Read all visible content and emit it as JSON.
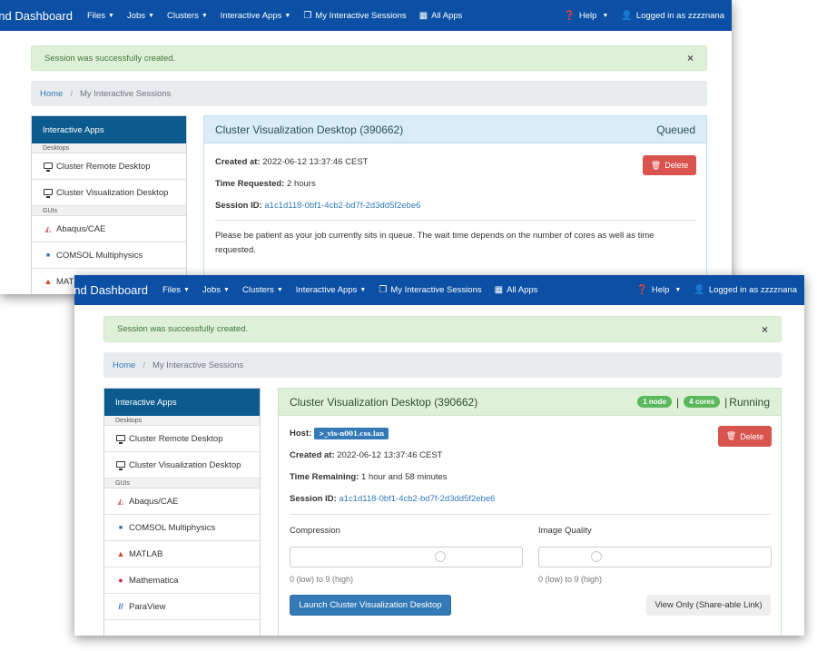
{
  "brand": "emand Dashboard",
  "nav": {
    "files": "Files",
    "jobs": "Jobs",
    "clusters": "Clusters",
    "interactive_apps": "Interactive Apps",
    "my_sessions": "My Interactive Sessions",
    "all_apps": "All Apps",
    "help": "Help",
    "login": "Logged in as zzzznana"
  },
  "alert": {
    "text": "Session was successfully created.",
    "close": "×"
  },
  "breadcrumb": {
    "home": "Home",
    "separator": "/",
    "current": "My Interactive Sessions"
  },
  "sidebar": {
    "header": "Interactive Apps",
    "categories": {
      "desktops": "Desktops",
      "guis": "GUIs"
    },
    "items": {
      "remote_desktop": "Cluster Remote Desktop",
      "vis_desktop": "Cluster Visualization Desktop",
      "abaqus": "Abaqus/CAE",
      "comsol": "COMSOL Multiphysics",
      "matlab": "MATLAB",
      "matlab_partial": "MATL",
      "mathematica": "Mathematica",
      "paraview": "ParaView"
    }
  },
  "session": {
    "title": "Cluster Visualization Desktop (390662)",
    "created_label": "Created at:",
    "created_value": "2022-06-12 13:37:46 CEST",
    "session_id_label": "Session ID:",
    "session_id": "a1c1d118-0bf1-4cb2-bd7f-2d3dd5f2ebe6",
    "delete": "Delete"
  },
  "queued": {
    "status": "Queued",
    "time_requested_label": "Time Requested:",
    "time_requested_value": "2 hours",
    "message": "Please be patient as your job currently sits in queue. The wait time depends on the number of cores as well as time requested."
  },
  "running": {
    "nodes": "1 node",
    "cores": "4 cores",
    "separator": "|",
    "status": "Running",
    "host_label": "Host:",
    "host": ">_vis-n001.css.lan",
    "time_remaining_label": "Time Remaining:",
    "time_remaining_value": "1 hour and 58 minutes",
    "compression_label": "Compression",
    "compression_help": "0 (low) to 9 (high)",
    "quality_label": "Image Quality",
    "quality_help": "0 (low) to 9 (high)",
    "launch_button": "Launch Cluster Visualization Desktop",
    "view_only_button": "View Only (Share-able Link)"
  },
  "colors": {
    "navbar": "#0b50a4",
    "sidebar_header": "#0c5b8e",
    "alert_bg": "#dff0d8",
    "info_panel": "#d9edf7",
    "success_badge": "#5cb85c",
    "danger": "#d9534f",
    "primary": "#337ab7"
  },
  "icons": {
    "caret": "caret-down-icon",
    "sessions": "sessions-icon",
    "apps": "grid-icon",
    "help": "question-circle-icon",
    "user": "user-icon",
    "desktop": "monitor-icon",
    "trash": "trash-icon",
    "abaqus": "abaqus-icon",
    "comsol": "comsol-icon",
    "matlab": "matlab-icon",
    "mathematica": "mathematica-icon",
    "paraview": "paraview-icon"
  }
}
